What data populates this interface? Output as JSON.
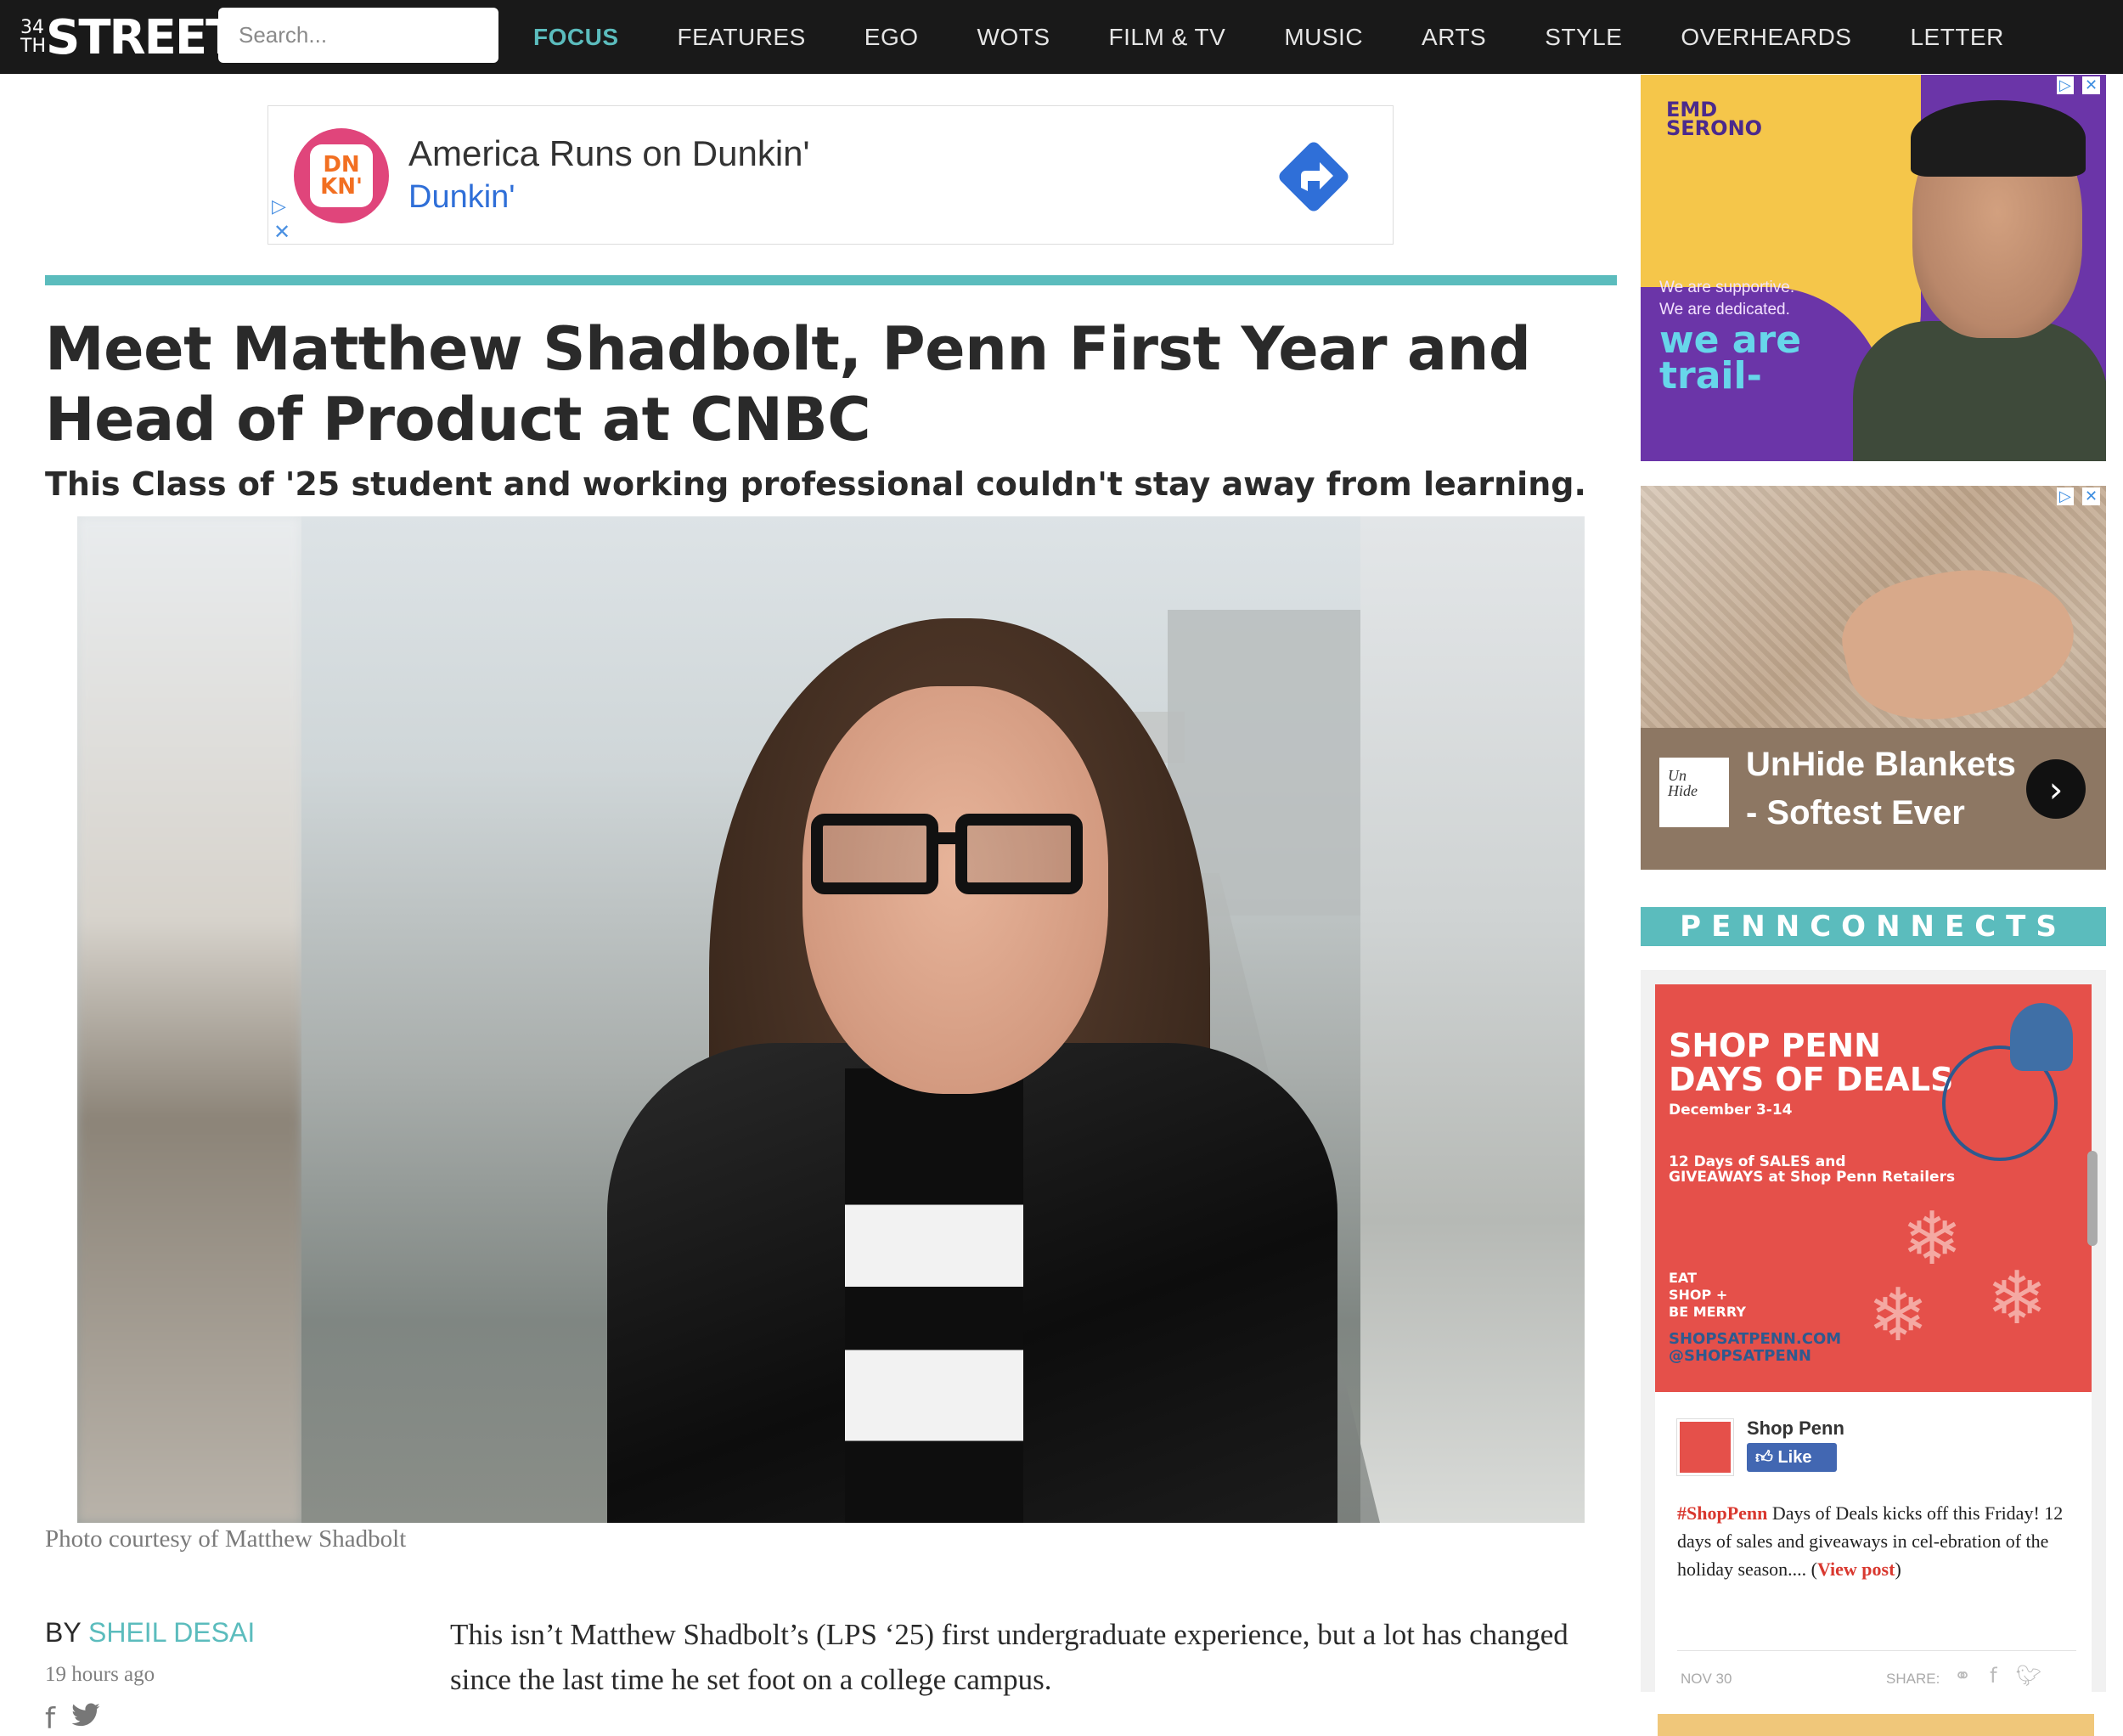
{
  "nav": {
    "logo_num_top": "34",
    "logo_num_bottom": "TH",
    "logo_word": "STREET",
    "search_placeholder": "Search...",
    "links": [
      "FOCUS",
      "FEATURES",
      "EGO",
      "WOTS",
      "FILM & TV",
      "MUSIC",
      "ARTS",
      "STYLE",
      "OVERHEARDS",
      "LETTER"
    ],
    "active": "FOCUS"
  },
  "top_ad": {
    "logo_text_1": "DN",
    "logo_text_2": "KN'",
    "headline": "America Runs on Dunkin'",
    "brand": "Dunkin'",
    "choice_icon": "▷",
    "close_icon": "✕"
  },
  "article": {
    "headline": "Meet Matthew Shadbolt, Penn First Year and Head of Product at CNBC",
    "subhead": "This Class of '25 student and working professional couldn't stay away from learning.",
    "photo_caption": "Photo courtesy of Matthew Shadbolt",
    "by_label": "BY",
    "author": "SHEIL DESAI",
    "timestamp": "19 hours ago",
    "body": "This isn’t Matthew Shadbolt’s (LPS ‘25) first undergraduate experience, but a lot has changed since the last time he set foot on a college campus."
  },
  "sidebar": {
    "emd_ad": {
      "logo_1": "EMD",
      "logo_2": "SERONO",
      "tag_1": "We are supportive.",
      "tag_2": "We are dedicated.",
      "big_1": "we are",
      "big_2": "trail-"
    },
    "unhide_ad": {
      "logo_1": "Un",
      "logo_2": "Hide",
      "title_1": "UnHide Blankets",
      "title_2": "- Softest Ever",
      "arrow": "›"
    },
    "pennconnects": "PENNCONNECTS",
    "shop_penn": {
      "poster_title_1": "SHOP PENN",
      "poster_title_2": "DAYS OF DEALS",
      "poster_dates": "December 3-14",
      "poster_desc_1": "12 Days of SALES and",
      "poster_desc_2": "GIVEAWAYS at Shop Penn Retailers",
      "poster_eat_1": "EAT",
      "poster_eat_2": "SHOP +",
      "poster_eat_3": "BE MERRY",
      "poster_url_1": "SHOPSATPENN.COM",
      "poster_url_2": "@SHOPSATPENN",
      "page_name": "Shop Penn",
      "like_label": "Like",
      "post_hashtag": "#ShopPenn",
      "post_text": " Days of Deals kicks off this Friday! 12 days of sales and giveaways in cel-ebration of the holiday season.... (",
      "post_link": "View post",
      "post_end": ")",
      "date": "NOV 30",
      "share_label": "SHARE:"
    }
  },
  "colors": {
    "accent": "#5bbcbd",
    "nav_bg": "#191919",
    "dunkin_pink": "#e0457b",
    "dunkin_blue": "#2f6fd8",
    "shop_red": "#e5504a",
    "fb_blue": "#4267b2"
  }
}
